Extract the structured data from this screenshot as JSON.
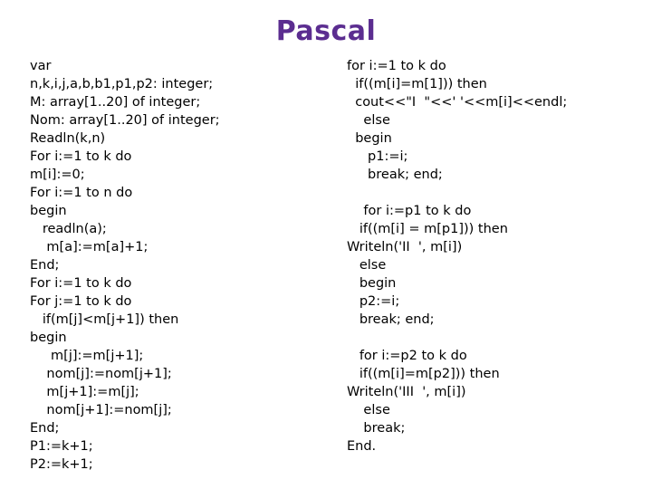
{
  "slide": {
    "title": "Pascal",
    "title_color": "#5B2D90",
    "background_color": "#FFFFFF",
    "text_color": "#000000"
  },
  "code_left": {
    "lines": [
      "var",
      "n,k,i,j,a,b,b1,p1,p2: integer;",
      "M: array[1..20] of integer;",
      "Nom: array[1..20] of integer;",
      "Readln(k,n)",
      "For i:=1 to k do",
      "m[i]:=0;",
      "For i:=1 to n do",
      "begin",
      "   readln(a);",
      "    m[a]:=m[a]+1;",
      "End;",
      "For i:=1 to k do",
      "For j:=1 to k do",
      "   if(m[j]<m[j+1]) then",
      "begin",
      "     m[j]:=m[j+1];",
      "    nom[j]:=nom[j+1];",
      "    m[j+1]:=m[j];",
      "    nom[j+1]:=nom[j];",
      "End;",
      "P1:=k+1;",
      "P2:=k+1;"
    ]
  },
  "code_right": {
    "lines": [
      "for i:=1 to k do",
      "  if((m[i]=m[1])) then",
      "  cout<<\"I  \"<<' '<<m[i]<<endl;",
      "    else",
      "  begin",
      "     p1:=i;",
      "     break; end;",
      "",
      "    for i:=p1 to k do",
      "   if((m[i] = m[p1])) then",
      "Writeln('II  ', m[i])",
      "   else",
      "   begin",
      "   p2:=i;",
      "   break; end;",
      "",
      "   for i:=p2 to k do",
      "   if((m[i]=m[p2])) then",
      "Writeln('III  ', m[i])",
      "    else",
      "    break;",
      "End."
    ]
  }
}
